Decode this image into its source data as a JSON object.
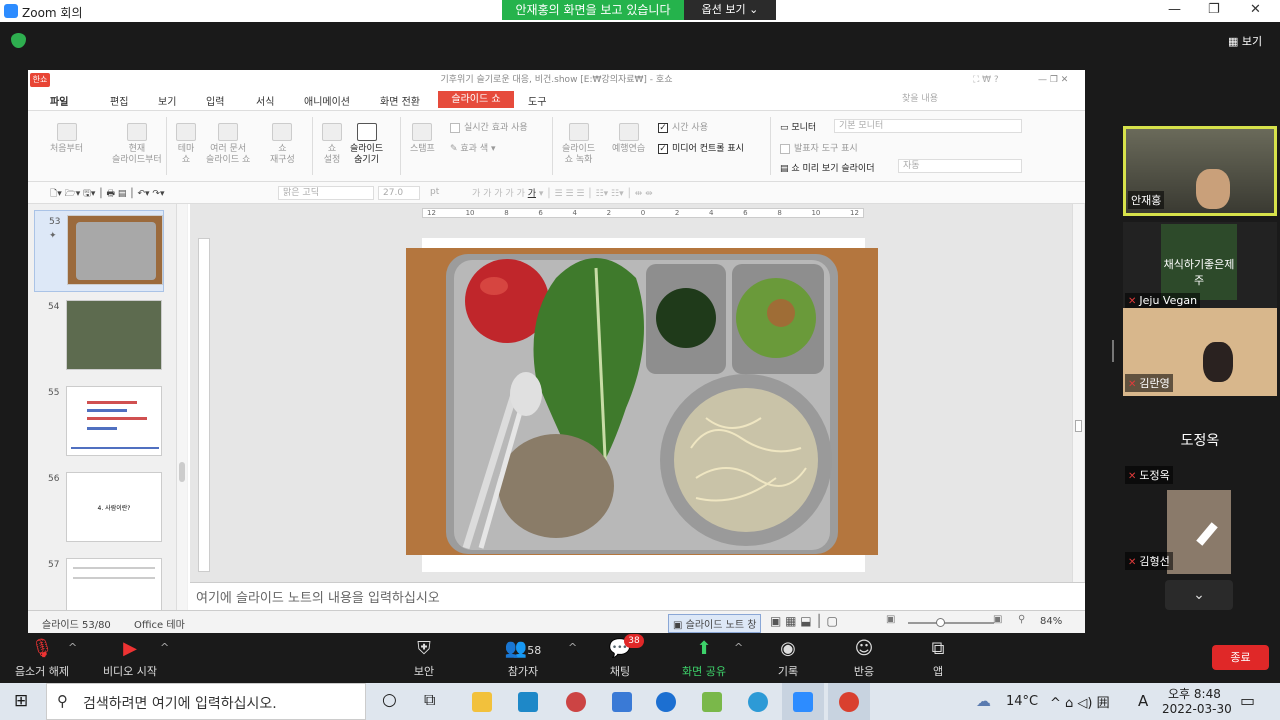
{
  "zoom": {
    "window_title": "Zoom 회의",
    "share_banner": "안재홍의 화면을 보고 있습니다",
    "view_options": "옵션 보기 ⌄",
    "view_button": "보기",
    "participants": [
      {
        "name": "안재홍",
        "muted": false
      },
      {
        "name": "Jeju Vegan",
        "muted": true
      },
      {
        "name": "김란영",
        "muted": true
      },
      {
        "name": "도정옥",
        "muted": true,
        "display_text": "도정옥"
      },
      {
        "name": "김형선",
        "muted": true
      }
    ],
    "jeju_vegan_banner": "채식하기좋은제주",
    "toolbar": {
      "unmute": "음소거 해제",
      "start_video": "비디오 시작",
      "security": "보안",
      "participants": "참가자",
      "participant_count": "58",
      "chat": "채팅",
      "chat_badge": "38",
      "share_screen": "화면 공유",
      "record": "기록",
      "reactions": "반응",
      "apps": "앱",
      "end": "종료"
    }
  },
  "hancom": {
    "title": "기후위기 슬기로운 대응, 비건.show [E:₩강의자료₩] - 호쇼",
    "logo": "한쇼",
    "menu": [
      "파일",
      "편집",
      "보기",
      "입력",
      "서식",
      "애니메이션",
      "화면 전환",
      "슬라이드 쇼",
      "도구"
    ],
    "ribbon": {
      "from_start": "처음부터",
      "from_current": [
        "현재",
        "슬라이드부터"
      ],
      "theme_show": [
        "테마",
        "쇼"
      ],
      "multi_doc_show": [
        "여러 문서",
        "슬라이드 쇼"
      ],
      "reconfigure_show": [
        "쇼",
        "재구성"
      ],
      "show_setup": [
        "쇼",
        "설정"
      ],
      "hide_slide": [
        "슬라이드",
        "숨기기"
      ],
      "stamp": "스탬프",
      "realtime_effect": "실시간 효과 사용",
      "effect_color": "효과 색",
      "record_show": [
        "슬라이드",
        "쇼 녹화"
      ],
      "rehearse": "예행연습",
      "show_time": "시간 사용",
      "show_media_controls": "미디어 컨트롤 표시",
      "monitor": "모니터",
      "monitor_value": "기본 모니터",
      "presenter_tools": "발표자 도구 표시",
      "preview_slider": "쇼 미리 보기 슬라이더",
      "preview_value": "자동",
      "search_placeholder": "찾을 내용"
    },
    "format_bar": {
      "font": "맑은 고딕",
      "size": "27.0",
      "unit": "pt"
    },
    "slides": [
      {
        "number": "53",
        "selected": true
      },
      {
        "number": "54"
      },
      {
        "number": "55"
      },
      {
        "number": "56",
        "text": "4. 사람이란?"
      },
      {
        "number": "57"
      }
    ],
    "ruler_labels": [
      "12",
      "10",
      "8",
      "6",
      "4",
      "2",
      "0",
      "2",
      "4",
      "6",
      "8",
      "10",
      "12"
    ],
    "notes_placeholder": "여기에 슬라이드 노트의 내용을 입력하십시오",
    "status": {
      "slide": "슬라이드 53/80",
      "theme": "Office 테마",
      "notes_window": "슬라이드 노트 창",
      "zoom": "84%"
    }
  },
  "taskbar": {
    "search_placeholder": "검색하려면 여기에 입력하십시오.",
    "weather": "14°C",
    "lang": "A",
    "time": "오후 8:48",
    "date": "2022-03-30"
  }
}
